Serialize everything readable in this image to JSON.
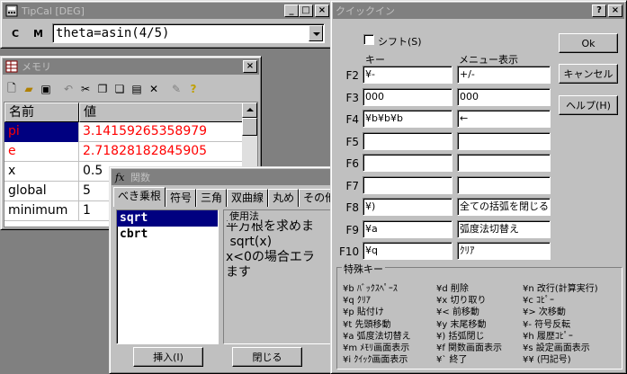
{
  "tipcal": {
    "title": "TipCal [DEG]",
    "c_label": "C",
    "m_label": "M",
    "expression": "theta=asin(4/5)"
  },
  "memory": {
    "title": "メモリ",
    "col_name": "名前",
    "col_value": "値",
    "rows": [
      {
        "name": "pi",
        "value": "3.14159265358979"
      },
      {
        "name": "e",
        "value": "2.71828182845905"
      },
      {
        "name": "x",
        "value": "0.5"
      },
      {
        "name": "global",
        "value": "5"
      },
      {
        "name": "minimum",
        "value": "1"
      }
    ]
  },
  "functions": {
    "title": "関数",
    "tabs": [
      "べき乗根",
      "符号",
      "三角",
      "双曲線",
      "丸め",
      "その他"
    ],
    "items": [
      "sqrt",
      "cbrt"
    ],
    "usage_label": "使用法",
    "usage_text": "平方根を求めま\n sqrt(x)\nx<0の場合エラ\nます",
    "insert_button": "挿入(I)",
    "close_button": "閉じる"
  },
  "quick": {
    "title": "クイックイン",
    "help_btn": "?",
    "close_btn": "×",
    "shift_label": "シフト(S)",
    "key_header": "キー",
    "menu_header": "メニュー表示",
    "ok_button": "Ok",
    "cancel_button": "キャンセル",
    "help_button": "ヘルプ(H)",
    "rows": [
      {
        "fkey": "F2",
        "key": "¥-",
        "menu": "+/-"
      },
      {
        "fkey": "F3",
        "key": "000",
        "menu": "000"
      },
      {
        "fkey": "F4",
        "key": "¥b¥b¥b",
        "menu": "←"
      },
      {
        "fkey": "F5",
        "key": "",
        "menu": ""
      },
      {
        "fkey": "F6",
        "key": "",
        "menu": ""
      },
      {
        "fkey": "F7",
        "key": "",
        "menu": ""
      },
      {
        "fkey": "F8",
        "key": "¥)",
        "menu": "全ての括弧を閉じる"
      },
      {
        "fkey": "F9",
        "key": "¥a",
        "menu": "弧度法切替え"
      },
      {
        "fkey": "F10",
        "key": "¥q",
        "menu": "ｸﾘｱ"
      }
    ],
    "special_label": "特殊キー",
    "special": [
      [
        "¥b ﾊﾞｯｸｽﾍﾟｰｽ",
        "¥d 削除",
        "¥n 改行(計算実行)"
      ],
      [
        "¥q ｸﾘｱ",
        "¥x 切り取り",
        "¥c ｺﾋﾟｰ"
      ],
      [
        "¥p 貼付け",
        "¥< 前移動",
        "¥> 次移動"
      ],
      [
        "¥t 先頭移動",
        "¥y 末尾移動",
        "¥- 符号反転"
      ],
      [
        "¥a 弧度法切替え",
        "¥) 括弧閉じ",
        "¥h 履歴ｺﾋﾟｰ"
      ],
      [
        "¥m ﾒﾓﾘ画面表示",
        "¥f 関数画面表示",
        "¥s 設定画面表示"
      ],
      [
        "¥i ｸｲｯｸ画面表示",
        "¥` 終了",
        "¥¥ (円記号)"
      ]
    ]
  }
}
